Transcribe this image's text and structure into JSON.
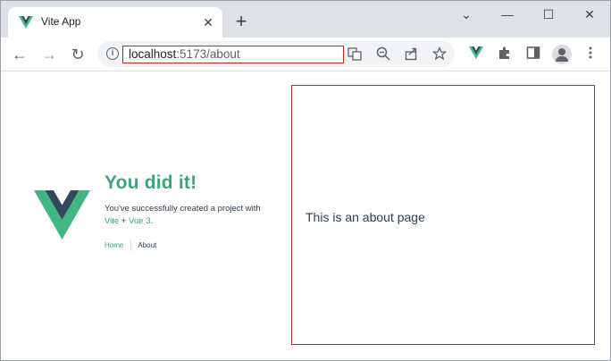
{
  "tab": {
    "title": "Vite App",
    "close_glyph": "✕",
    "new_tab_glyph": "+"
  },
  "window": {
    "minimize_glyph": "—",
    "restore_glyph": "☐",
    "close_glyph": "✕",
    "collapse_glyph": "⌄"
  },
  "toolbar": {
    "url_host": "localhost",
    "url_rest": ":5173/about",
    "back_glyph": "←",
    "forward_glyph": "→",
    "reload_glyph": "↻"
  },
  "page": {
    "greeting": "You did it!",
    "subtext_prefix": "You've successfully created a project with",
    "link_vite": "Vite",
    "plus": " + ",
    "link_vue": "Vue 3",
    "period": ".",
    "nav": {
      "home": "Home",
      "about": "About"
    },
    "about_text": "This is an about page"
  },
  "colors": {
    "accent": "#3aa675",
    "vue_dark": "#35495e",
    "text": "#2c3e50",
    "highlight_border": "#cc2222"
  }
}
